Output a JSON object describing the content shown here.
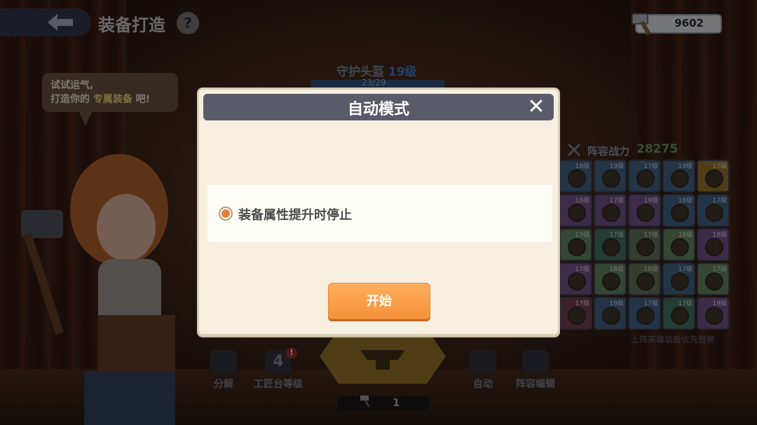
{
  "header": {
    "title": "装备打造",
    "help": "?",
    "currency_value": "9602"
  },
  "bubble": {
    "line1": "试试运气,",
    "line2_prefix": "打造你的",
    "line2_highlight": "专属装备",
    "line2_suffix": "吧!"
  },
  "item": {
    "name": "守护头盔",
    "level": "19级",
    "progress": "23/29"
  },
  "power": {
    "label": "阵容战力",
    "value": "28275"
  },
  "grid": {
    "levels": [
      [
        "18级",
        "19级",
        "17级",
        "19级",
        "17级"
      ],
      [
        "18级",
        "17级",
        "19级",
        "18级",
        "17级"
      ],
      [
        "19级",
        "17级",
        "17级",
        "19级",
        "18级"
      ],
      [
        "17级",
        "18级",
        "18级",
        "17级",
        "17级"
      ],
      [
        "17级",
        "19级",
        "17级",
        "17级",
        "19级"
      ]
    ],
    "colors": [
      [
        "#3d5a7a",
        "#3d5a7a",
        "#3d5a7a",
        "#3d5a7a",
        "#8a6a2a"
      ],
      [
        "#6a4a80",
        "#6a4a80",
        "#6a4a80",
        "#3d5a7a",
        "#3d5a7a"
      ],
      [
        "#5a7a5a",
        "#3d6a5a",
        "#5a6a50",
        "#5a7a5a",
        "#6a4a80"
      ],
      [
        "#6a4a80",
        "#5a7a5a",
        "#5a6a50",
        "#3d5a7a",
        "#5a7a5a"
      ],
      [
        "#6a3a4a",
        "#3d5a7a",
        "#3d5a7a",
        "#3d6a5a",
        "#6a4a80"
      ]
    ],
    "priority_note": "上阵英雄装备优先替换"
  },
  "toolbar": {
    "disassemble": "分解",
    "workbench_level": "工匠台等级",
    "workbench_number": "4",
    "badge": "!",
    "auto": "自动",
    "lineup_edit": "阵容编辑",
    "hammer_count": "1"
  },
  "modal": {
    "title": "自动模式",
    "close": "✕",
    "option_label": "装备属性提升时停止",
    "option_checked": true,
    "start_label": "开始"
  },
  "colors": {
    "accent": "#f5923a",
    "modal_bg": "#f6efe0",
    "header_bg": "#595b68",
    "radio": "#e27c36"
  }
}
